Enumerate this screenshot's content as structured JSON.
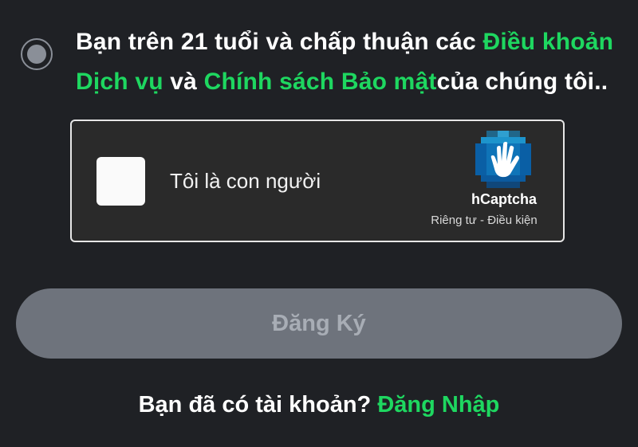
{
  "consent": {
    "text_before": "Bạn trên 21 tuổi và chấp thuận các ",
    "terms_link": "Điều khoản Dịch vụ",
    "text_middle": " và ",
    "privacy_link": "Chính sách Bảo mật",
    "text_after": "của chúng tôi.."
  },
  "captcha": {
    "label": "Tôi là con người",
    "brand": "hCaptcha",
    "privacy_link": "Riêng tư",
    "separator": " - ",
    "terms_link": "Điều kiện"
  },
  "submit": {
    "label": "Đăng Ký"
  },
  "login": {
    "prompt": "Bạn đã có tài khoản? ",
    "link": "Đăng Nhập"
  },
  "colors": {
    "background": "#1f2125",
    "accent": "#1ed760",
    "button": "#6e737c"
  }
}
